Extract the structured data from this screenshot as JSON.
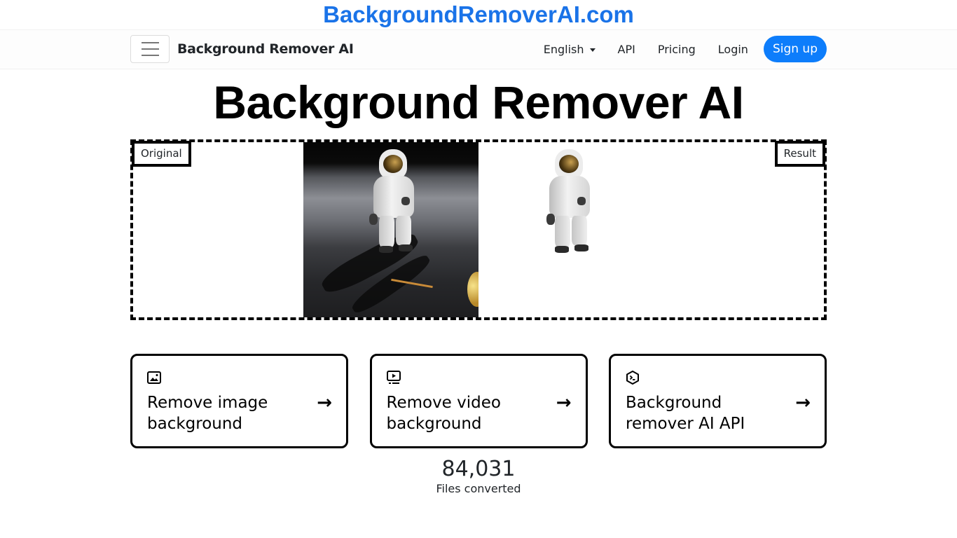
{
  "banner": {
    "text": "BackgroundRemoverAI.com"
  },
  "navbar": {
    "brand": "Background Remover AI",
    "language": "English",
    "links": [
      "API",
      "Pricing",
      "Login"
    ],
    "signup": "Sign up",
    "accent_color": "#0d7dfb"
  },
  "hero": {
    "title": "Background Remover AI"
  },
  "comparison": {
    "original_label": "Original",
    "result_label": "Result",
    "original_image": "astronaut-on-moon-photo",
    "result_image": "astronaut-cutout"
  },
  "cards": [
    {
      "icon": "image-icon",
      "label": "Remove image background",
      "arrow": "→"
    },
    {
      "icon": "video-icon",
      "label": "Remove video background",
      "arrow": "→"
    },
    {
      "icon": "terminal-icon",
      "label": "Background remover AI API",
      "arrow": "→"
    }
  ],
  "stats": {
    "value": "84,031",
    "label": "Files converted"
  }
}
